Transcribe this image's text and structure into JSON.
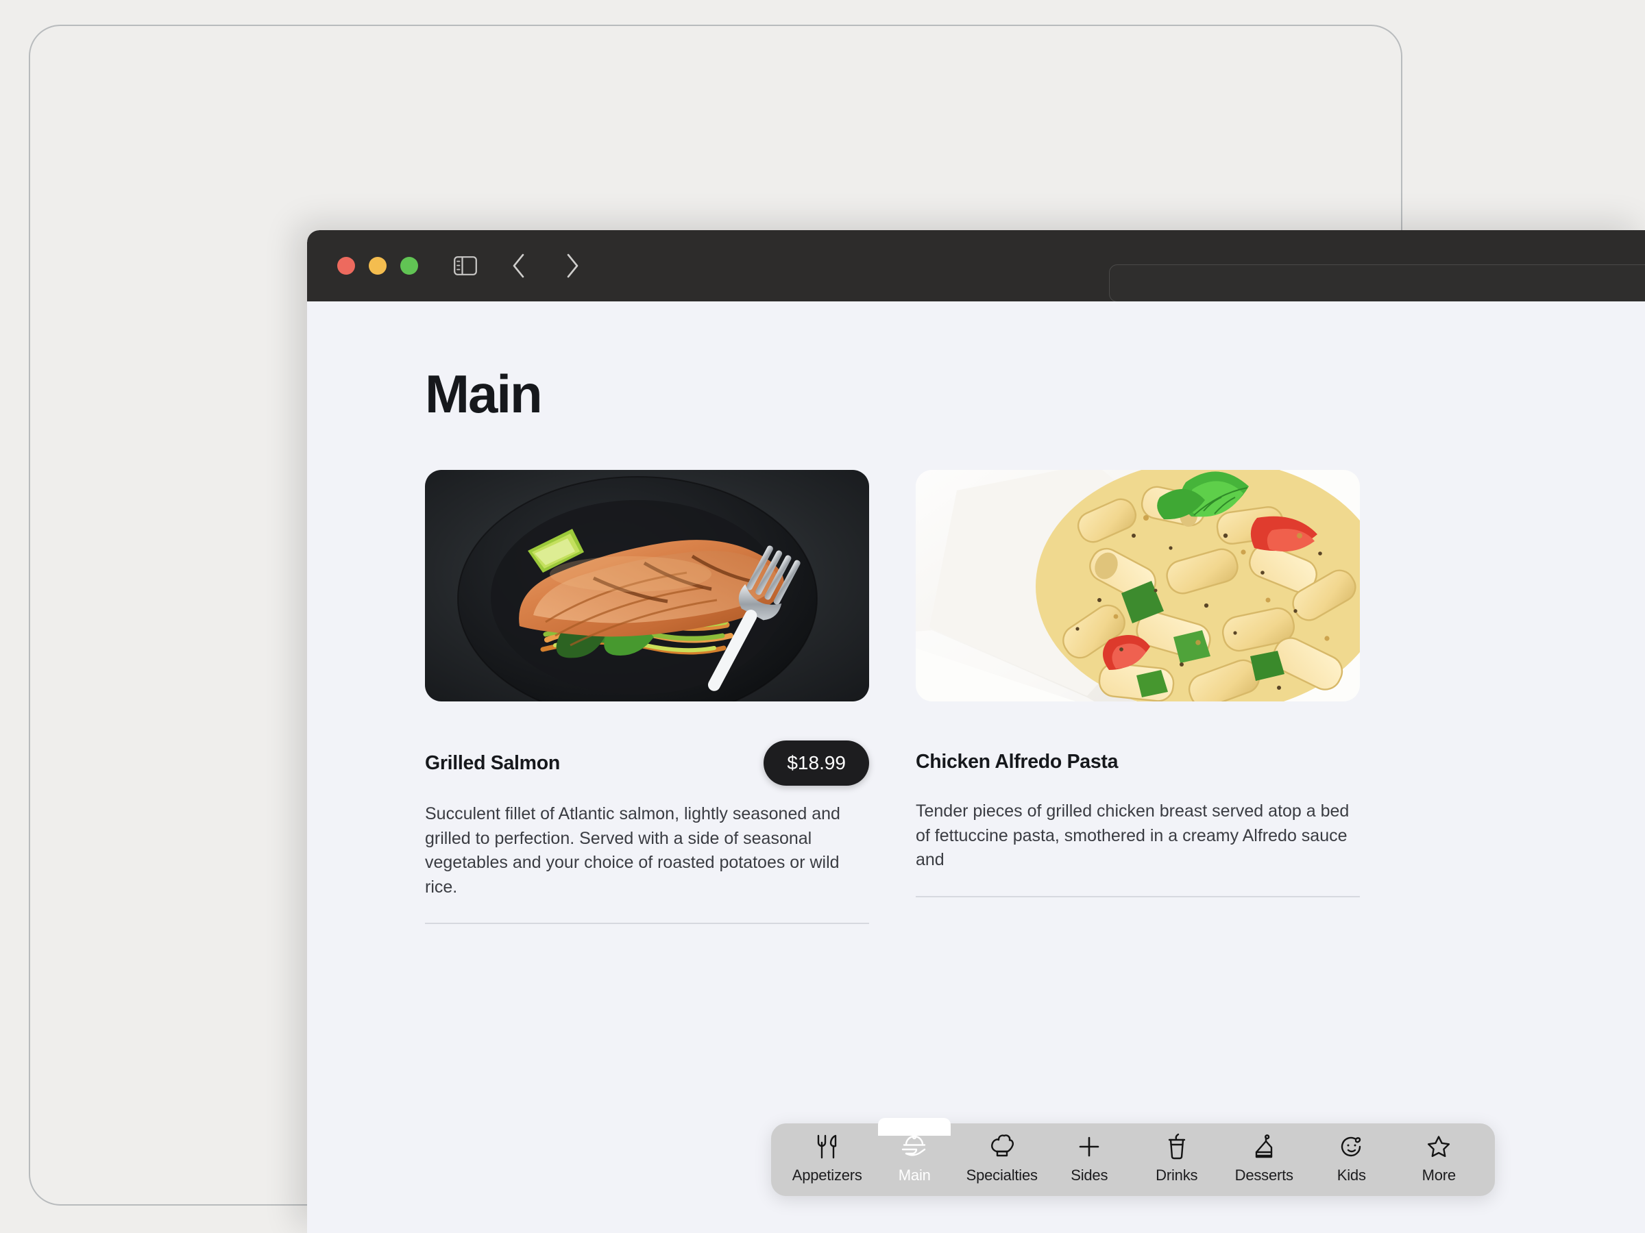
{
  "window": {
    "traffic_lights": [
      {
        "name": "close",
        "color": "#ed6a5e"
      },
      {
        "name": "minimize",
        "color": "#f4bd4f"
      },
      {
        "name": "zoom",
        "color": "#61c454"
      }
    ],
    "toolbar": {
      "sidebar_toggle": "sidebar-icon",
      "back": "chevron-left-icon",
      "forward": "chevron-right-icon",
      "reload": "reload-icon"
    },
    "address_bar": {
      "value": "",
      "placeholder": ""
    }
  },
  "page": {
    "title": "Main",
    "cards": [
      {
        "name": "Grilled Salmon",
        "price": "$18.99",
        "description": "Succulent fillet of Atlantic salmon, lightly seasoned and grilled to perfection. Served with a side of seasonal vegetables and your choice of roasted potatoes or wild rice.",
        "image_alt": "grilled-salmon-photo"
      },
      {
        "name": "Chicken Alfredo Pasta",
        "price": "",
        "description": "Tender pieces of grilled chicken breast served atop a bed of fettuccine pasta, smothered in a creamy Alfredo sauce and",
        "image_alt": "chicken-alfredo-pasta-photo"
      }
    ]
  },
  "tabbar": {
    "active_index": 1,
    "tabs": [
      {
        "label": "Appetizers",
        "icon": "fork-knife-icon"
      },
      {
        "label": "Main",
        "icon": "cloche-serving-icon"
      },
      {
        "label": "Specialties",
        "icon": "chef-hat-icon"
      },
      {
        "label": "Sides",
        "icon": "plus-icon"
      },
      {
        "label": "Drinks",
        "icon": "drink-cup-icon"
      },
      {
        "label": "Desserts",
        "icon": "cake-slice-icon"
      },
      {
        "label": "Kids",
        "icon": "baby-face-icon"
      },
      {
        "label": "More",
        "icon": "star-icon"
      }
    ]
  },
  "colors": {
    "outer_background": "#efeeec",
    "page_background": "#f2f3f8",
    "toolbar_background": "#2d2c2b",
    "price_pill": "#1d1d1f",
    "tabbar_background": "#cdcdcd",
    "text_primary": "#16181c",
    "text_secondary": "#3a3c42"
  }
}
